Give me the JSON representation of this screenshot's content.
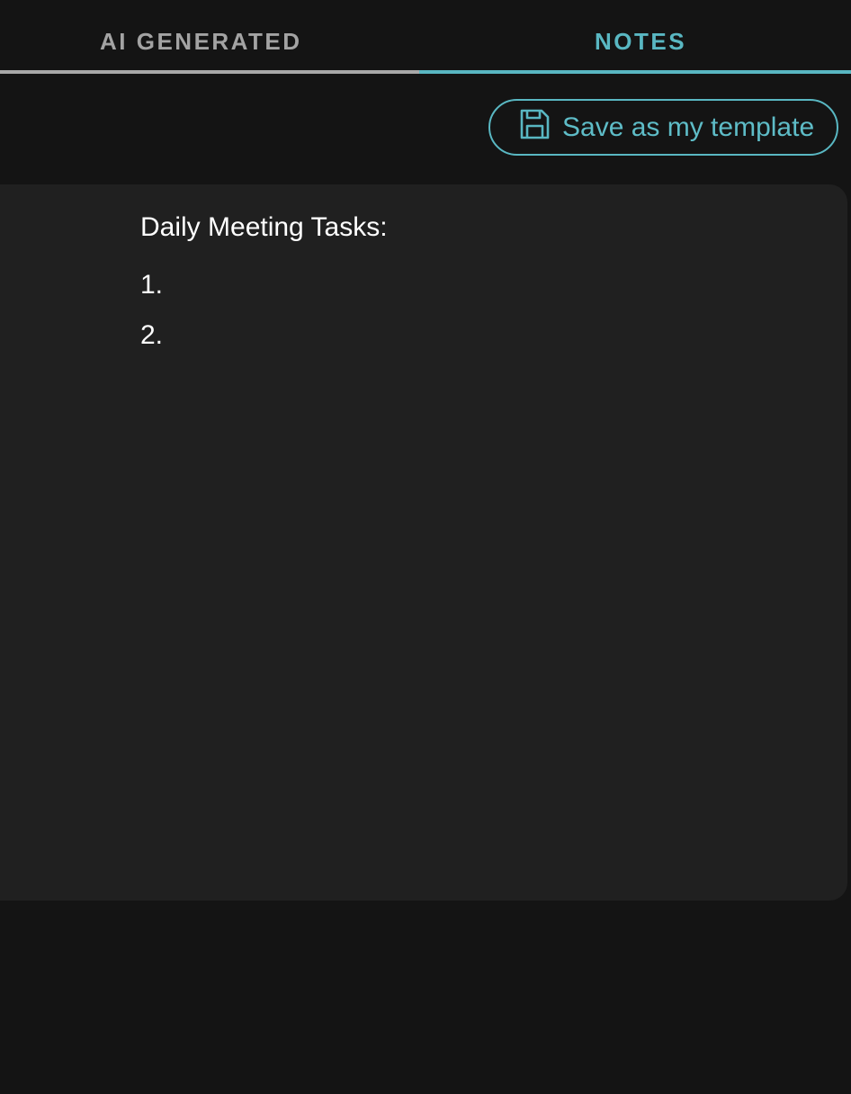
{
  "tabs": [
    {
      "label": "AI GENERATED",
      "active": false
    },
    {
      "label": "NOTES",
      "active": true
    }
  ],
  "toolbar": {
    "save_template_label": "Save as my template",
    "save_icon": "floppy-disk-icon"
  },
  "notes": {
    "heading": "Daily Meeting Tasks:",
    "items": [
      "1.",
      "2."
    ]
  },
  "colors": {
    "background": "#141414",
    "editor_background": "#202020",
    "accent": "#59b7c2",
    "inactive_tab": "#a3a3a3",
    "text": "#ffffff"
  }
}
